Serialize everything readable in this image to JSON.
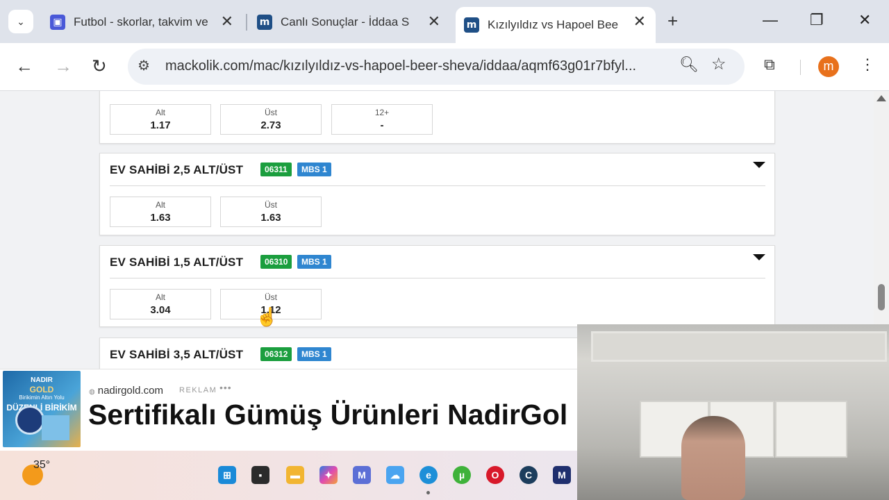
{
  "browser": {
    "tabs": [
      {
        "title": "Futbol - skorlar, takvim ve",
        "favicon": "flashscore-icon",
        "color": "#4a59d8",
        "active": false
      },
      {
        "title": "Canlı Sonuçlar - İddaa S",
        "favicon": "mackolik-icon",
        "color": "#1f4f86",
        "active": false
      },
      {
        "title": "Kızılyıldız vs Hapoel Bee",
        "favicon": "mackolik-icon",
        "color": "#1f4f86",
        "active": true
      }
    ],
    "url": "mackolik.com/mac/kızılyıldız-vs-hapoel-beer-sheva/iddaa/aqmf63g01r7bfyl...",
    "profile_initial": "m"
  },
  "markets": [
    {
      "title": "",
      "code": "",
      "mbs": "",
      "odds": [
        {
          "label": "Alt",
          "value": "1.17"
        },
        {
          "label": "Üst",
          "value": "2.73"
        },
        {
          "label": "12+",
          "value": "-"
        }
      ]
    },
    {
      "title": "EV SAHİBİ 2,5 ALT/ÜST",
      "code": "06311",
      "mbs": "MBS 1",
      "odds": [
        {
          "label": "Alt",
          "value": "1.63"
        },
        {
          "label": "Üst",
          "value": "1.63"
        }
      ]
    },
    {
      "title": "EV SAHİBİ 1,5 ALT/ÜST",
      "code": "06310",
      "mbs": "MBS 1",
      "odds": [
        {
          "label": "Alt",
          "value": "3.04"
        },
        {
          "label": "Üst",
          "value": "1.12"
        }
      ]
    },
    {
      "title": "EV SAHİBİ 3,5 ALT/ÜST",
      "code": "06312",
      "mbs": "MBS 1",
      "odds": []
    }
  ],
  "ad": {
    "domain": "nadirgold.com",
    "label": "REKLAM",
    "headline": "Sertifikalı Gümüş Ürünleri NadirGol",
    "image_text": {
      "brand": "NADIR",
      "brand2": "GOLD",
      "tagline": "Birikimin Altın Yolu",
      "slogan": "DÜZENLİ BİRİKİM"
    }
  },
  "taskbar": {
    "temperature": "35°",
    "icons": [
      "windows-start-icon",
      "task-view-icon",
      "file-explorer-icon",
      "copilot-icon",
      "mackolik-app-icon",
      "cloud-icon",
      "edge-icon",
      "utorrent-icon",
      "opera-icon",
      "ccleaner-icon",
      "m-app-icon"
    ]
  },
  "colors": {
    "code_badge": "#1b9e3e",
    "mbs_badge": "#2f86d0",
    "avatar": "#e8711c"
  }
}
